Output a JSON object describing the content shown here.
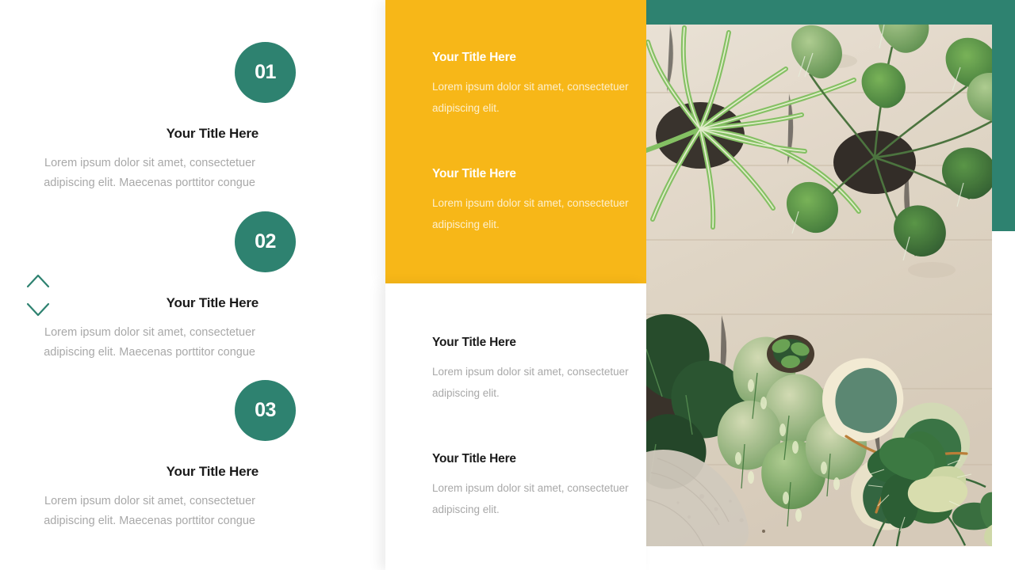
{
  "theme": {
    "teal": "#2e8270",
    "yellow": "#f7b718",
    "title_dark": "#1a1a1a",
    "body_gray": "#a8a8a8",
    "body_on_yellow": "#fdf0cf",
    "white": "#ffffff"
  },
  "left_column": {
    "steps": [
      {
        "number": "01",
        "title": "Your Title Here",
        "body": "Lorem ipsum dolor sit amet, consectetuer adipiscing elit. Maecenas porttitor congue"
      },
      {
        "number": "02",
        "title": "Your Title Here",
        "body": "Lorem ipsum dolor sit amet, consectetuer adipiscing elit. Maecenas porttitor congue"
      },
      {
        "number": "03",
        "title": "Your Title Here",
        "body": "Lorem ipsum dolor sit amet, consectetuer adipiscing elit. Maecenas porttitor congue"
      }
    ],
    "nav": {
      "up_icon": "chevron-up-icon",
      "down_icon": "chevron-down-icon"
    }
  },
  "center_column": {
    "yellow_panel": {
      "blocks": [
        {
          "title": "Your Title Here",
          "body": "Lorem ipsum dolor sit amet, consectetuer adipiscing elit."
        },
        {
          "title": "Your Title Here",
          "body": "Lorem ipsum dolor sit amet, consectetuer adipiscing elit."
        }
      ]
    },
    "white_panel": {
      "blocks": [
        {
          "title": "Your Title Here",
          "body": "Lorem ipsum dolor sit amet, consectetuer adipiscing elit."
        },
        {
          "title": "Your Title Here",
          "body": "Lorem ipsum dolor sit amet, consectetuer adipiscing elit."
        }
      ]
    }
  },
  "right_column": {
    "photo": {
      "icon": "houseplants-photo",
      "description": "Top-down photo of assorted green houseplants on a pale wooden floor"
    },
    "accent_top_bar": "teal-accent-bar",
    "accent_side_block": "teal-accent-block"
  }
}
